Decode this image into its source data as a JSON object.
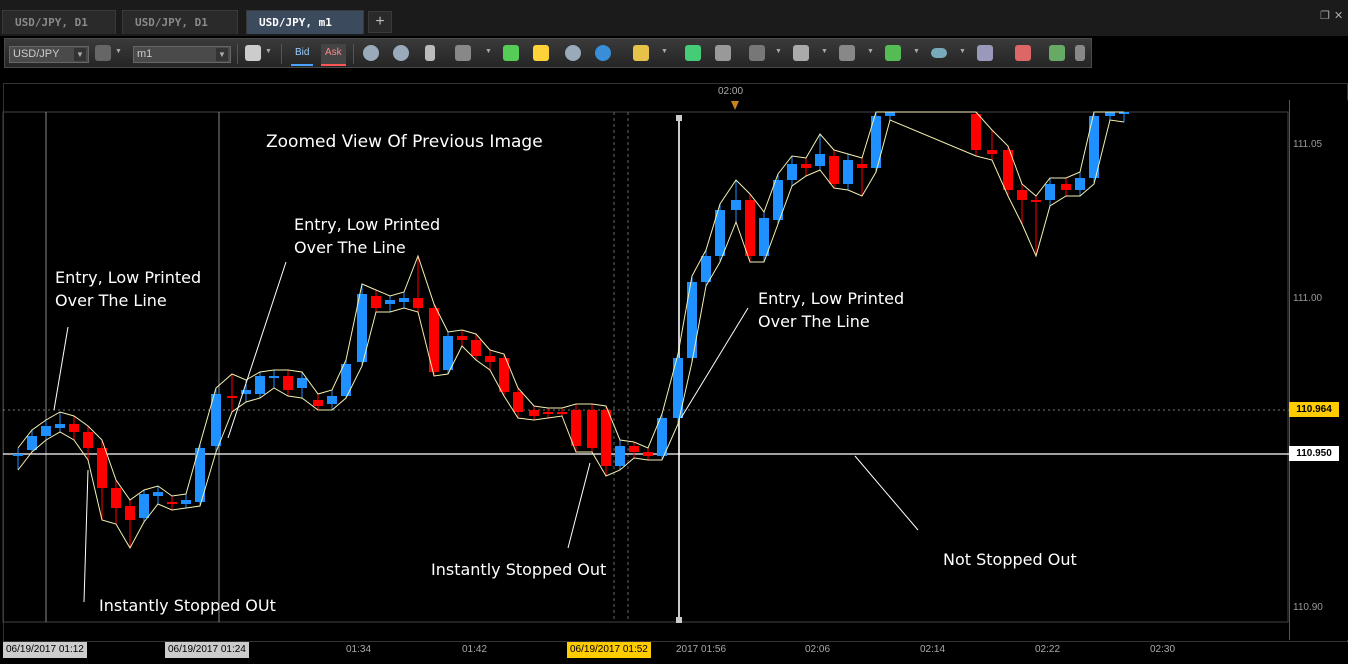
{
  "tabs": [
    {
      "label": "USD/JPY, D1",
      "active": false
    },
    {
      "label": "USD/JPY, D1",
      "active": false
    },
    {
      "label": "USD/JPY, m1",
      "active": true
    }
  ],
  "tab_add": "+",
  "toolbar": {
    "symbol_combo": "USD/JPY",
    "timeframe_combo": "m1",
    "bid_label": "Bid",
    "ask_label": "Ask",
    "icons": [
      "chart-type-icon",
      "crosshair-icon",
      "zoom-icon",
      "cursor-icon",
      "select-icon",
      "fit-icon",
      "comment-icon",
      "eye-icon",
      "globe-icon",
      "ruler-icon",
      "indicator-icon",
      "layers-icon",
      "fibonacci-icon",
      "channel-icon",
      "trendline-icon",
      "pencil-icon",
      "ellipse-icon",
      "text-icon",
      "eraser-icon",
      "tree-icon",
      "list-icon"
    ]
  },
  "chart": {
    "top_time_label": "02:00",
    "title_annotation": "Zoomed View Of Previous Image",
    "annotations": [
      {
        "text": "Entry, Low Printed\nOver The Line"
      },
      {
        "text": "Entry, Low Printed\nOver The Line"
      },
      {
        "text": "Entry, Low Printed\nOver The Line"
      },
      {
        "text": "Instantly Stopped OUt"
      },
      {
        "text": "Instantly Stopped Out"
      },
      {
        "text": "Not Stopped Out"
      }
    ],
    "y_labels": [
      "111.05",
      "111.00",
      "110.90"
    ],
    "price_tag_current": "110.964",
    "price_tag_line": "110.950",
    "x_labels": [
      "01:34",
      "01:42",
      "02:06",
      "02:14",
      "02:22",
      "02:30"
    ],
    "x_tags": [
      "06/19/2017 01:12",
      "06/19/2017 01:24",
      "06/19/2017 01:52",
      "2017 01:56"
    ],
    "colors": {
      "bull": "#1e90ff",
      "bear": "#ff0000",
      "tag_current": "#ffcc00",
      "tag_line": "#ffffff"
    }
  }
}
